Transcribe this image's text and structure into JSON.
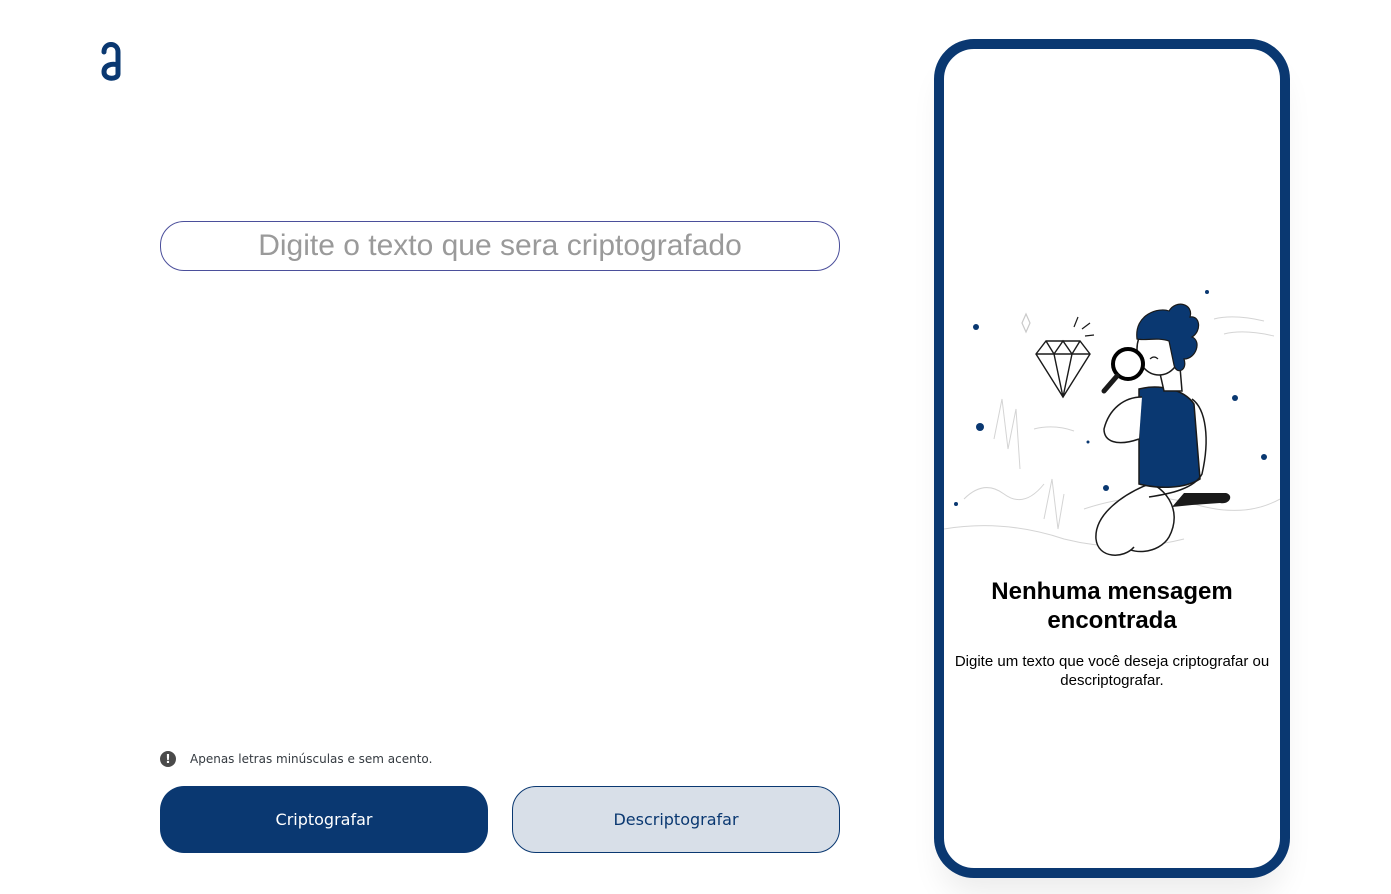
{
  "brand": {
    "logo_icon": "alura-a-logo-icon",
    "color": "#0a3871"
  },
  "input": {
    "placeholder": "Digite o texto que sera criptografado",
    "value": ""
  },
  "hint": {
    "icon": "exclamation-circle-icon",
    "text": "Apenas letras minúsculas e sem acento."
  },
  "buttons": {
    "encrypt_label": "Criptografar",
    "decrypt_label": "Descriptografar"
  },
  "output_panel": {
    "illustration": "person-with-magnifying-glass-and-diamond",
    "title": "Nenhuma mensagem encontrada",
    "message": "Digite um texto que você deseja criptografar ou descriptografar."
  },
  "colors": {
    "primary": "#0a3871",
    "secondary_bg": "#d8dfe8",
    "input_border": "#4b4f9b"
  }
}
